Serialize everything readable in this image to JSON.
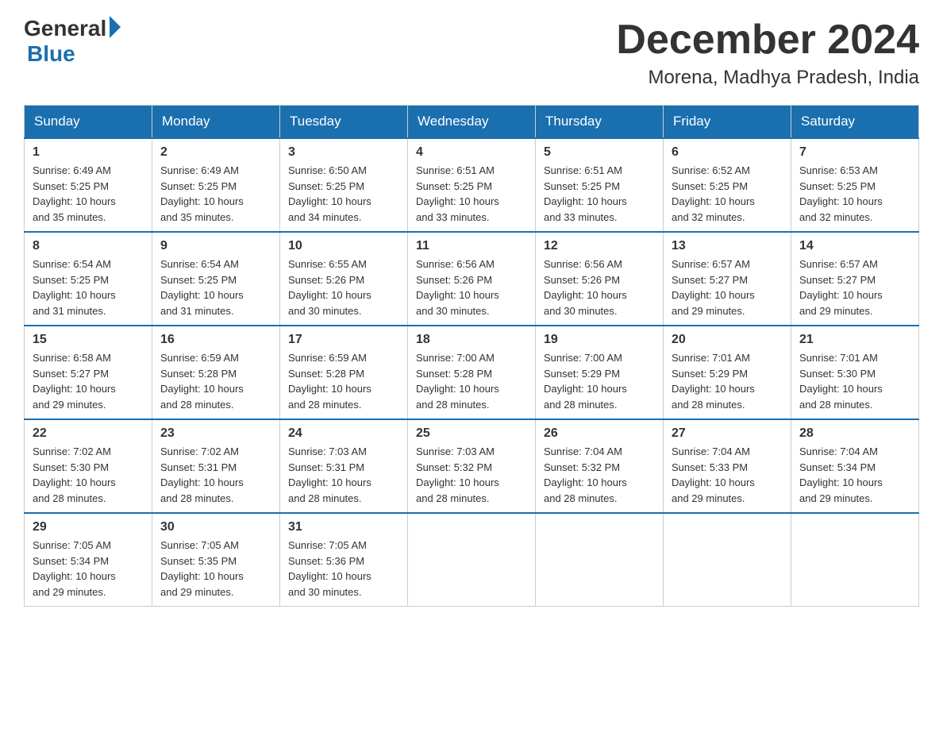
{
  "header": {
    "logo_general": "General",
    "logo_blue": "Blue",
    "month_year": "December 2024",
    "location": "Morena, Madhya Pradesh, India"
  },
  "days_of_week": [
    "Sunday",
    "Monday",
    "Tuesday",
    "Wednesday",
    "Thursday",
    "Friday",
    "Saturday"
  ],
  "weeks": [
    [
      {
        "day": "1",
        "sunrise": "6:49 AM",
        "sunset": "5:25 PM",
        "daylight": "10 hours and 35 minutes."
      },
      {
        "day": "2",
        "sunrise": "6:49 AM",
        "sunset": "5:25 PM",
        "daylight": "10 hours and 35 minutes."
      },
      {
        "day": "3",
        "sunrise": "6:50 AM",
        "sunset": "5:25 PM",
        "daylight": "10 hours and 34 minutes."
      },
      {
        "day": "4",
        "sunrise": "6:51 AM",
        "sunset": "5:25 PM",
        "daylight": "10 hours and 33 minutes."
      },
      {
        "day": "5",
        "sunrise": "6:51 AM",
        "sunset": "5:25 PM",
        "daylight": "10 hours and 33 minutes."
      },
      {
        "day": "6",
        "sunrise": "6:52 AM",
        "sunset": "5:25 PM",
        "daylight": "10 hours and 32 minutes."
      },
      {
        "day": "7",
        "sunrise": "6:53 AM",
        "sunset": "5:25 PM",
        "daylight": "10 hours and 32 minutes."
      }
    ],
    [
      {
        "day": "8",
        "sunrise": "6:54 AM",
        "sunset": "5:25 PM",
        "daylight": "10 hours and 31 minutes."
      },
      {
        "day": "9",
        "sunrise": "6:54 AM",
        "sunset": "5:25 PM",
        "daylight": "10 hours and 31 minutes."
      },
      {
        "day": "10",
        "sunrise": "6:55 AM",
        "sunset": "5:26 PM",
        "daylight": "10 hours and 30 minutes."
      },
      {
        "day": "11",
        "sunrise": "6:56 AM",
        "sunset": "5:26 PM",
        "daylight": "10 hours and 30 minutes."
      },
      {
        "day": "12",
        "sunrise": "6:56 AM",
        "sunset": "5:26 PM",
        "daylight": "10 hours and 30 minutes."
      },
      {
        "day": "13",
        "sunrise": "6:57 AM",
        "sunset": "5:27 PM",
        "daylight": "10 hours and 29 minutes."
      },
      {
        "day": "14",
        "sunrise": "6:57 AM",
        "sunset": "5:27 PM",
        "daylight": "10 hours and 29 minutes."
      }
    ],
    [
      {
        "day": "15",
        "sunrise": "6:58 AM",
        "sunset": "5:27 PM",
        "daylight": "10 hours and 29 minutes."
      },
      {
        "day": "16",
        "sunrise": "6:59 AM",
        "sunset": "5:28 PM",
        "daylight": "10 hours and 28 minutes."
      },
      {
        "day": "17",
        "sunrise": "6:59 AM",
        "sunset": "5:28 PM",
        "daylight": "10 hours and 28 minutes."
      },
      {
        "day": "18",
        "sunrise": "7:00 AM",
        "sunset": "5:28 PM",
        "daylight": "10 hours and 28 minutes."
      },
      {
        "day": "19",
        "sunrise": "7:00 AM",
        "sunset": "5:29 PM",
        "daylight": "10 hours and 28 minutes."
      },
      {
        "day": "20",
        "sunrise": "7:01 AM",
        "sunset": "5:29 PM",
        "daylight": "10 hours and 28 minutes."
      },
      {
        "day": "21",
        "sunrise": "7:01 AM",
        "sunset": "5:30 PM",
        "daylight": "10 hours and 28 minutes."
      }
    ],
    [
      {
        "day": "22",
        "sunrise": "7:02 AM",
        "sunset": "5:30 PM",
        "daylight": "10 hours and 28 minutes."
      },
      {
        "day": "23",
        "sunrise": "7:02 AM",
        "sunset": "5:31 PM",
        "daylight": "10 hours and 28 minutes."
      },
      {
        "day": "24",
        "sunrise": "7:03 AM",
        "sunset": "5:31 PM",
        "daylight": "10 hours and 28 minutes."
      },
      {
        "day": "25",
        "sunrise": "7:03 AM",
        "sunset": "5:32 PM",
        "daylight": "10 hours and 28 minutes."
      },
      {
        "day": "26",
        "sunrise": "7:04 AM",
        "sunset": "5:32 PM",
        "daylight": "10 hours and 28 minutes."
      },
      {
        "day": "27",
        "sunrise": "7:04 AM",
        "sunset": "5:33 PM",
        "daylight": "10 hours and 29 minutes."
      },
      {
        "day": "28",
        "sunrise": "7:04 AM",
        "sunset": "5:34 PM",
        "daylight": "10 hours and 29 minutes."
      }
    ],
    [
      {
        "day": "29",
        "sunrise": "7:05 AM",
        "sunset": "5:34 PM",
        "daylight": "10 hours and 29 minutes."
      },
      {
        "day": "30",
        "sunrise": "7:05 AM",
        "sunset": "5:35 PM",
        "daylight": "10 hours and 29 minutes."
      },
      {
        "day": "31",
        "sunrise": "7:05 AM",
        "sunset": "5:36 PM",
        "daylight": "10 hours and 30 minutes."
      },
      null,
      null,
      null,
      null
    ]
  ],
  "labels": {
    "sunrise": "Sunrise:",
    "sunset": "Sunset:",
    "daylight": "Daylight:"
  }
}
